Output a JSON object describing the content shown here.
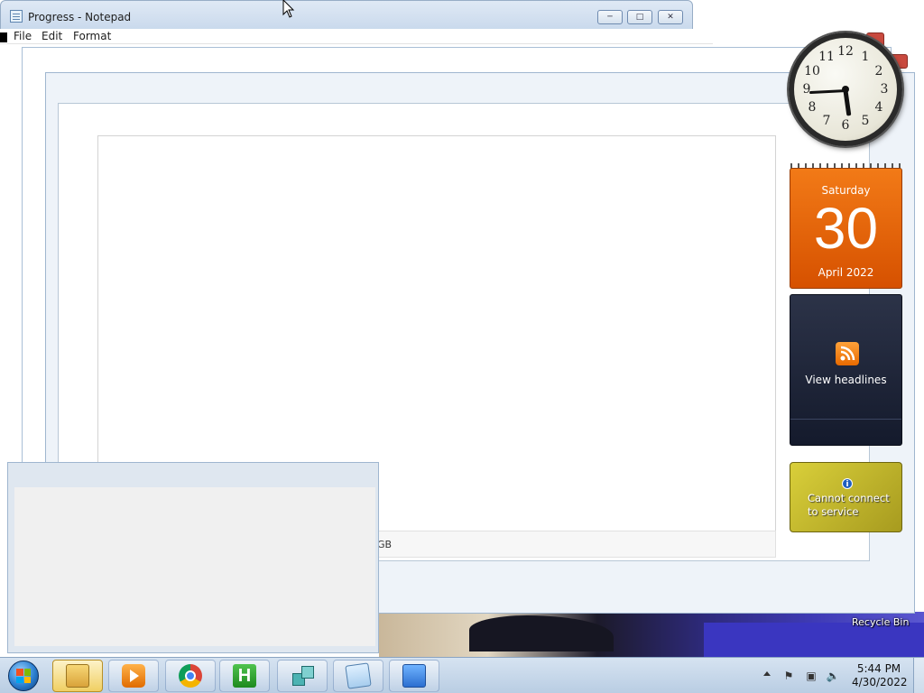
{
  "notepad": {
    "title": "Progress - Notepad",
    "menu": [
      "File",
      "Edit",
      "Format"
    ]
  },
  "background": {
    "fragment_text": "GB"
  },
  "desktop": {
    "recycle_bin_label": "Recycle Bin"
  },
  "gadgets": {
    "clock": {
      "numbers": [
        "12",
        "1",
        "2",
        "3",
        "4",
        "5",
        "6",
        "7",
        "8",
        "9",
        "10",
        "11"
      ],
      "time": "5:44"
    },
    "calendar": {
      "day_name": "Saturday",
      "day_number": "30",
      "month_year": "April 2022"
    },
    "feeds": {
      "label": "View headlines",
      "icon": "rss-icon"
    },
    "weather": {
      "message": "Cannot connect to service",
      "icon": "info-icon"
    }
  },
  "taskbar": {
    "start_icon": "windows-start-orb",
    "items": [
      {
        "name": "explorer",
        "icon": "folder-icon",
        "active": true
      },
      {
        "name": "media-player",
        "icon": "media-player-icon",
        "active": false
      },
      {
        "name": "chrome",
        "icon": "chrome-icon",
        "active": false
      },
      {
        "name": "h-editor",
        "icon": "h-app-icon",
        "letter": "H",
        "active": false
      },
      {
        "name": "cubes-app",
        "icon": "cubes-icon",
        "active": false
      },
      {
        "name": "notepad",
        "icon": "notepad-icon",
        "active": false
      },
      {
        "name": "task-manager",
        "icon": "task-manager-icon",
        "active": false
      }
    ],
    "tray": {
      "time": "5:44 PM",
      "date": "4/30/2022"
    }
  },
  "colors": {
    "calendar_orange": "#e86a0a",
    "feeds_dark": "#1e2438",
    "weather_yellow": "#c9be2e",
    "taskbar_blue": "#c6d7ea"
  }
}
